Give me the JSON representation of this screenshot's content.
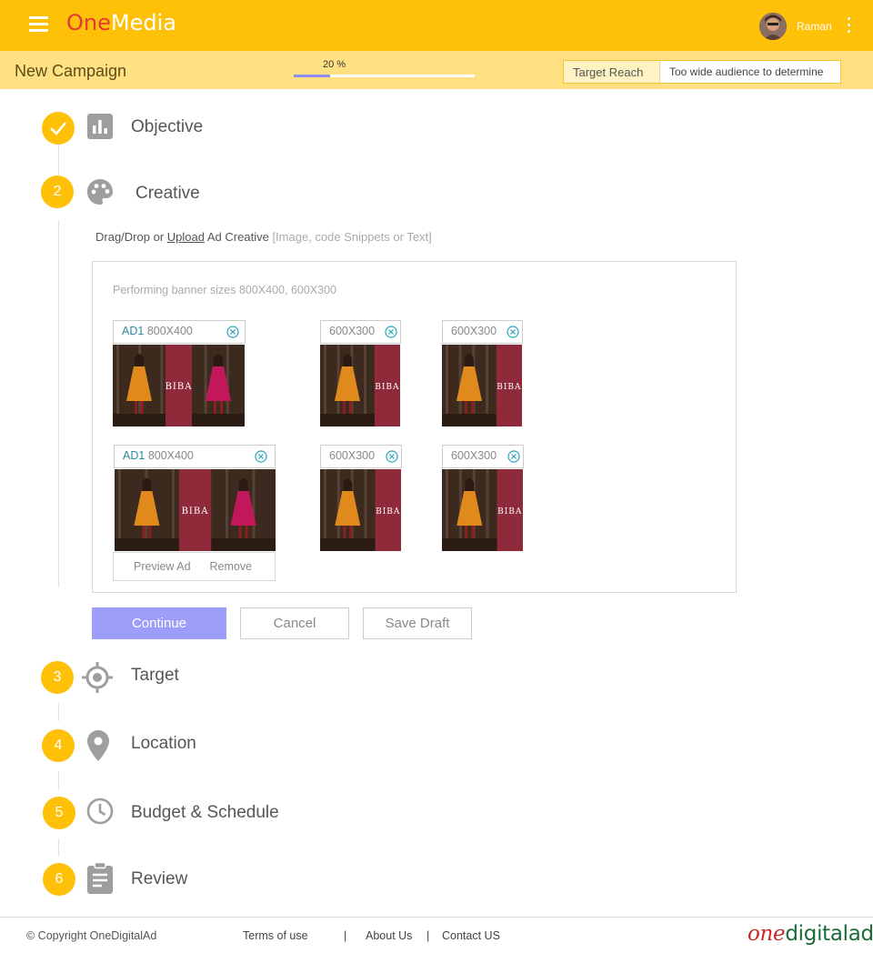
{
  "app": {
    "brand_part1": "One",
    "brand_part2": "Media",
    "username": "Raman"
  },
  "header": {
    "page_title": "New Campaign",
    "progress_label": "20 %",
    "progress_value": 0.2,
    "reach_label": "Target Reach",
    "reach_value": "Too wide audience to determine"
  },
  "steps": [
    {
      "number": "",
      "title": "Objective",
      "icon": "bar-chart-icon",
      "state": "completed"
    },
    {
      "number": "2",
      "title": "Creative",
      "icon": "palette-icon",
      "state": "active"
    },
    {
      "number": "3",
      "title": "Target",
      "icon": "target-icon",
      "state": "pending"
    },
    {
      "number": "4",
      "title": "Location",
      "icon": "location-pin-icon",
      "state": "pending"
    },
    {
      "number": "5",
      "title": "Budget & Schedule",
      "icon": "clock-icon",
      "state": "pending"
    },
    {
      "number": "6",
      "title": "Review",
      "icon": "clipboard-icon",
      "state": "pending"
    }
  ],
  "creative": {
    "instr_part1": "Drag/Drop",
    "instr_or": "or",
    "instr_upload": "Upload",
    "instr_part2": "Ad Creative",
    "instr_hint": "[Image, code Snippets or Text]",
    "panel_hint": "Performing  banner sizes   800X400,  600X300",
    "ads": [
      {
        "tag": "AD1",
        "size": "800X400"
      },
      {
        "tag": "",
        "size": "600X300"
      },
      {
        "tag": "",
        "size": "600X300"
      },
      {
        "tag": "AD1",
        "size": "800X400"
      },
      {
        "tag": "",
        "size": "600X300"
      },
      {
        "tag": "",
        "size": "600X300"
      }
    ],
    "banner_text": "BIBA",
    "preview_label": "Preview  Ad",
    "remove_label": "Remove"
  },
  "buttons": {
    "continue": "Continue",
    "cancel": "Cancel",
    "save_draft": "Save Draft"
  },
  "footer": {
    "copyright": "© Copyright OneDigitalAd",
    "terms": "Terms of use",
    "about": "About Us",
    "contact": "Contact US",
    "sep": "|",
    "logo_part1": "one",
    "logo_part2": "digitalad"
  },
  "colors": {
    "accent": "#ffc107",
    "subbar": "#ffe082",
    "primary_button": "#9d9dfa",
    "brand_red": "#e53935"
  }
}
